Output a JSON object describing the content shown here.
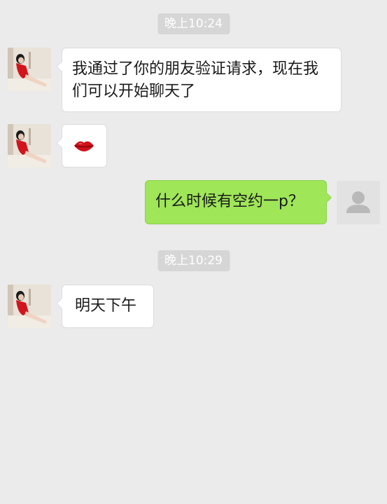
{
  "messages": [
    {
      "kind": "time",
      "text": "晚上10:24"
    },
    {
      "kind": "received",
      "text": "我通过了你的朋友验证请求，现在我们可以开始聊天了"
    },
    {
      "kind": "received",
      "emoji": "lips-emoji"
    },
    {
      "kind": "sent",
      "text": "什么时候有空约一p？"
    },
    {
      "kind": "time",
      "text": "晚上10:29"
    },
    {
      "kind": "received",
      "text": "明天下午"
    }
  ],
  "colors": {
    "background": "#ebebeb",
    "timestamp_bg": "#d6d6d6",
    "incoming_bubble": "#ffffff",
    "outgoing_bubble": "#9fe658",
    "lips": "#d0101a"
  },
  "icons": {
    "contact_avatar": "contact-avatar-photo-woman-red-dress",
    "self_avatar": "default-user-avatar-icon"
  }
}
